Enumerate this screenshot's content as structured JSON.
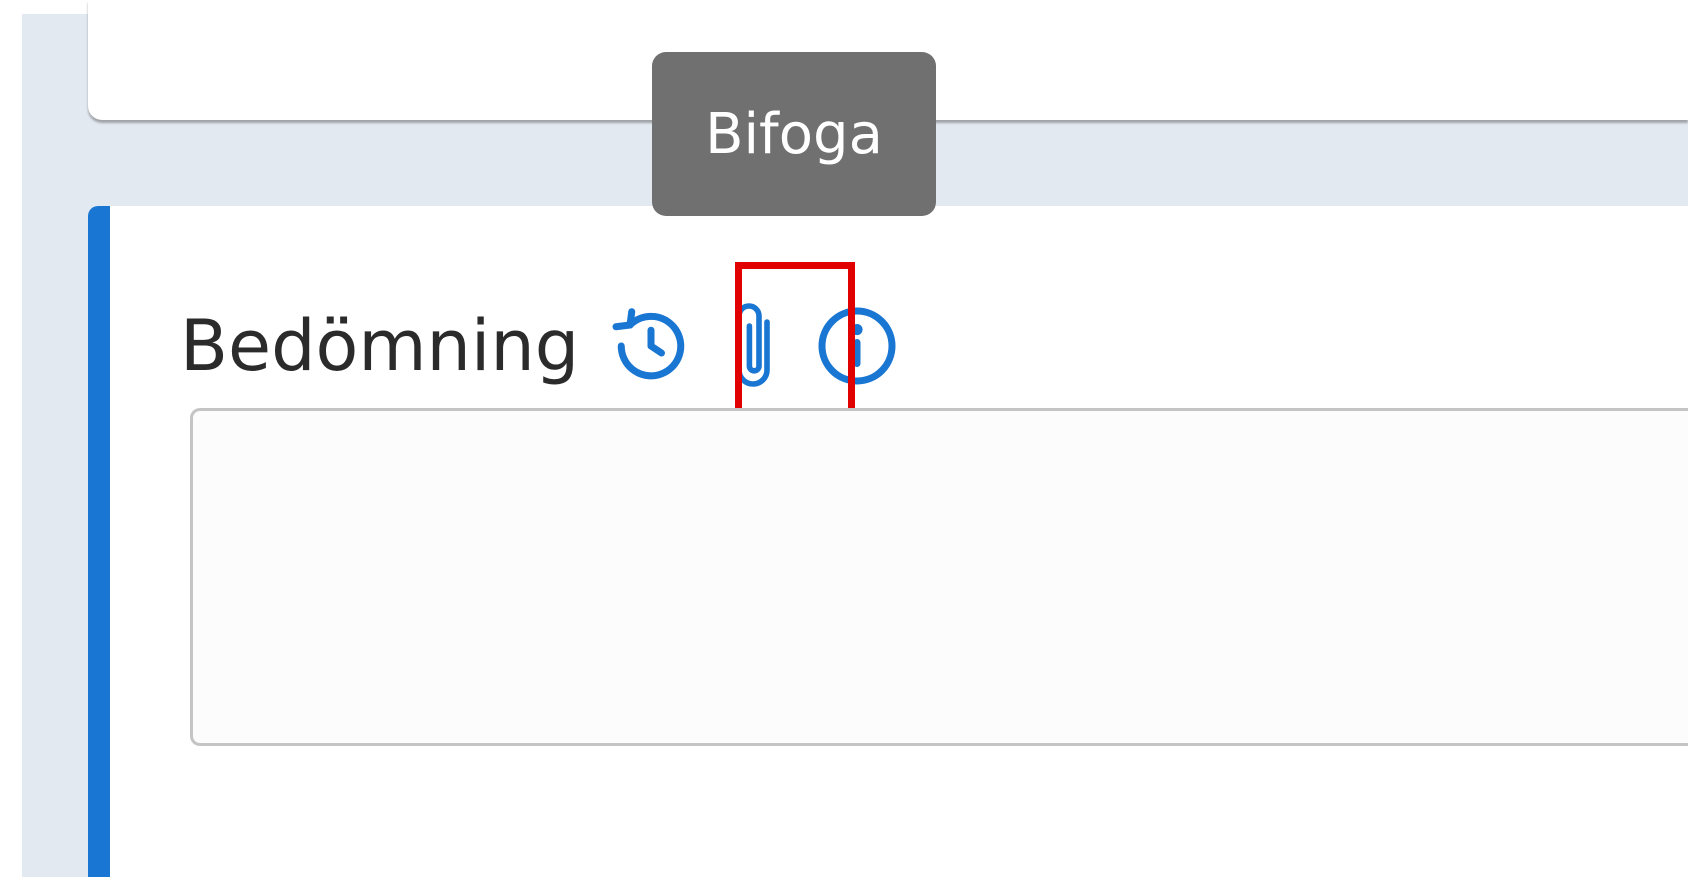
{
  "section": {
    "title": "Bedömning",
    "textarea_value": ""
  },
  "tooltip": {
    "text": "Bifoga"
  },
  "icons": {
    "history": "history-icon",
    "attach": "paperclip-icon",
    "info": "info-icon"
  },
  "colors": {
    "accent": "#1976d2",
    "icon": "#1976d2",
    "tooltip_bg": "#707070",
    "highlight": "#e00000",
    "app_bg": "#e3e9f1"
  }
}
